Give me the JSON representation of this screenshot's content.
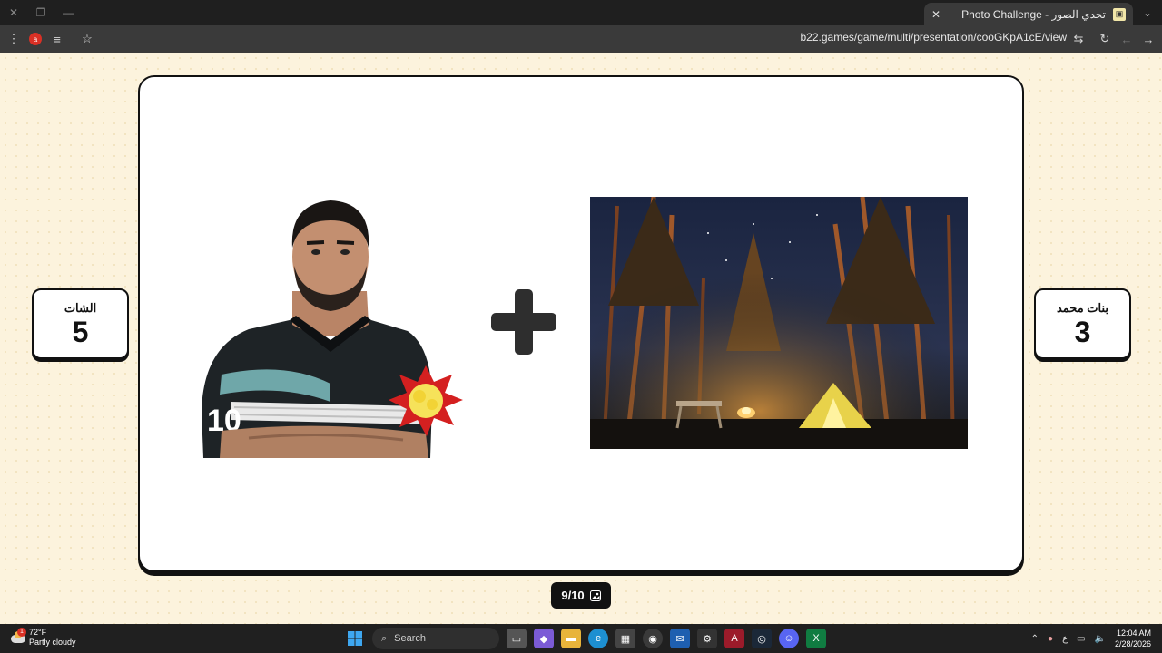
{
  "browser": {
    "tab_title": "تحدي الصور - Photo Challenge",
    "url": "b22.games/game/multi/presentation/cooGKpA1cE/view",
    "profile_initial": "a"
  },
  "game": {
    "left_team": {
      "name": "الشات",
      "score": "5"
    },
    "right_team": {
      "name": "بنات محمد",
      "score": "3"
    },
    "round_counter": "9/10",
    "operator_icon": "plus-icon",
    "accent_color": "#111111",
    "card_background": "#ffffff",
    "page_background": "#fcf3dd"
  },
  "taskbar": {
    "weather_temp": "72°F",
    "weather_desc": "Partly cloudy",
    "weather_badge": "1",
    "search_label": "Search",
    "time": "12:04 AM",
    "date": "2/28/2026",
    "input_lang": "ع"
  }
}
